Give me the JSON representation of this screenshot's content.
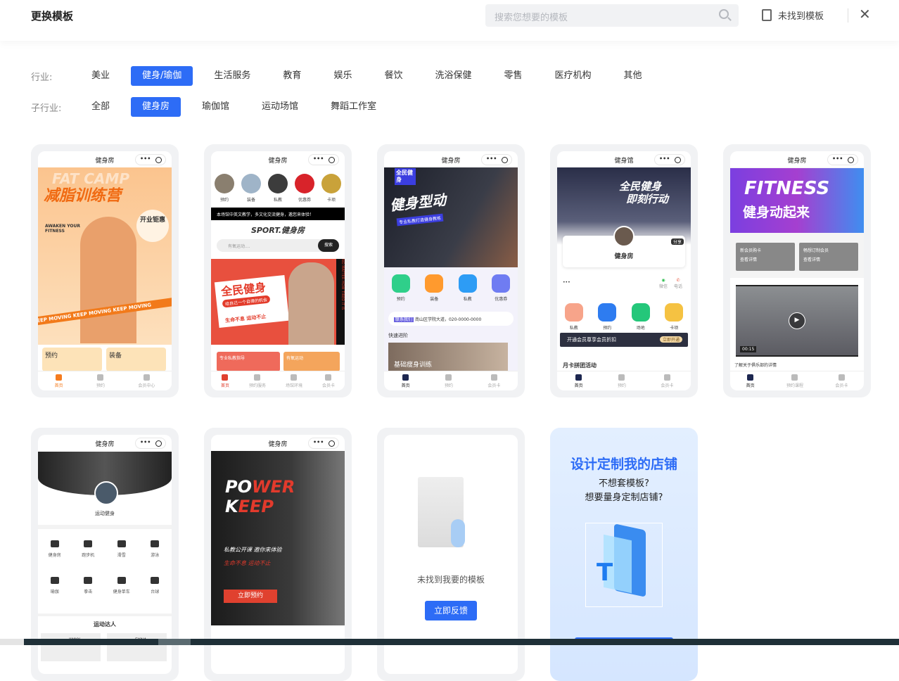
{
  "header": {
    "title": "更换模板",
    "search_placeholder": "搜索您想要的模板",
    "not_found": "未找到模板"
  },
  "filters": {
    "industry_label": "行业:",
    "industries": [
      "美业",
      "健身/瑜伽",
      "生活服务",
      "教育",
      "娱乐",
      "餐饮",
      "洗浴保健",
      "零售",
      "医疗机构",
      "其他"
    ],
    "industry_selected": 1,
    "sub_label": "子行业:",
    "subs": [
      "全部",
      "健身房",
      "瑜伽馆",
      "运动场馆",
      "舞蹈工作室"
    ],
    "sub_selected": 1
  },
  "templates": [
    {
      "title": "健身房",
      "banner": [
        "FAT CAMP",
        "减脂训练营",
        "开业钜惠",
        "AWAKEN YOUR FITNESS",
        "KEEP MOVING KEEP MOVING KEEP MOVING"
      ],
      "tiles": [
        "预约",
        "装备"
      ],
      "nav": [
        "首页",
        "预约",
        "会员中心"
      ]
    },
    {
      "title": "健身房",
      "icons": [
        "预约",
        "装备",
        "私教",
        "优惠券",
        "卡项"
      ],
      "notice": "本场馆中英文教学，多文化交流健身，邀您来体验！",
      "brand": "SPORT.健身房",
      "search_placeholder": "有氧运动....",
      "search_btn": "搜索",
      "banner": [
        "全民健身",
        "给自己一个自律的机会",
        "生命不息 运动不止",
        "NO MATTER HOW TIRED IT IS"
      ],
      "tiles": [
        "专业私教指导",
        "有氧运动"
      ],
      "nav": [
        "首页",
        "预约服务",
        "场馆环境",
        "会员卡"
      ]
    },
    {
      "title": "健身房",
      "banner": [
        "全民健身",
        "健身型动",
        "专业私教打造健身教练"
      ],
      "icons": [
        "预约",
        "装备",
        "私教",
        "优惠券"
      ],
      "contact": "联系我们",
      "address": "南山区学院大道，020-0000-0000",
      "section": "快速进阶",
      "course": "基础瘦身训练",
      "nav": [
        "首页",
        "预约",
        "会员卡"
      ]
    },
    {
      "title": "健身馆",
      "banner": [
        "全民健身",
        "即刻行动"
      ],
      "profile": "健身房",
      "share": "分享",
      "contacts": [
        "微信",
        "电话"
      ],
      "icons": [
        "私教",
        "预约",
        "场地",
        "卡项"
      ],
      "member": "开通会员尊享会员折扣",
      "member_btn": "立即开通",
      "section": "月卡拼团活动",
      "nav": [
        "首页",
        "预约",
        "会员卡"
      ]
    },
    {
      "title": "健身房",
      "banner": [
        "FITNESS",
        "健身动起来"
      ],
      "tiles": [
        {
          "t": "新会员购卡",
          "s": "查看详情"
        },
        {
          "t": "畅想订制会员",
          "s": "查看详情"
        }
      ],
      "video_time": "00:15",
      "video_caption": "了解关于俱乐部的详情",
      "nav": [
        "首页",
        "预约课程",
        "会员卡"
      ]
    },
    {
      "title": "健身房",
      "profile": "运动健身",
      "grid": [
        "健身房",
        "跑步机",
        "滑雪",
        "游泳",
        "瑜伽",
        "拳击",
        "健身单车",
        "台球"
      ],
      "section": "运动达人",
      "people": [
        "JIMKY",
        "EKNA"
      ]
    },
    {
      "title": "健身房",
      "banner": [
        "PO",
        "WER",
        "K",
        "EEP"
      ],
      "line1": "私教公开课 邀你来体验",
      "line2": "生命不息 运动不止",
      "btn": "立即预约"
    }
  ],
  "feedback": {
    "text": "未找到我要的模板",
    "btn": "立即反馈"
  },
  "custom": {
    "title": "设计定制我的店铺",
    "line1": "不想套模板?",
    "line2": "想要量身定制店铺?"
  }
}
